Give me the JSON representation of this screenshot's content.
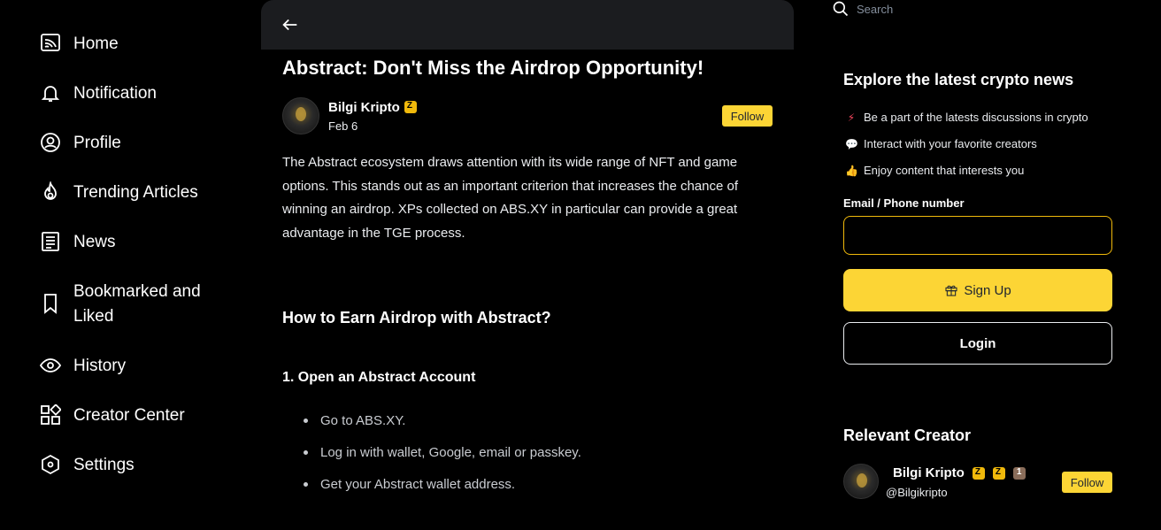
{
  "nav": {
    "items": [
      {
        "label": "Home",
        "icon": "home-screen-icon"
      },
      {
        "label": "Notification",
        "icon": "bell-icon"
      },
      {
        "label": "Profile",
        "icon": "user-icon"
      },
      {
        "label": "Trending Articles",
        "icon": "flame-icon"
      },
      {
        "label": "News",
        "icon": "news-icon"
      },
      {
        "label": "Bookmarked and Liked",
        "icon": "bookmark-icon"
      },
      {
        "label": "History",
        "icon": "eye-icon"
      },
      {
        "label": "Creator Center",
        "icon": "grid-icon"
      },
      {
        "label": "Settings",
        "icon": "settings-icon"
      }
    ]
  },
  "article": {
    "title": "Abstract: Don't Miss the Airdrop Opportunity!",
    "author": "Bilgi Kripto",
    "date": "Feb 6",
    "follow_label": "Follow",
    "paragraph": "The Abstract ecosystem draws attention with its wide range of NFT and game options. This stands out as an important criterion that increases the chance of winning an airdrop. XPs collected on ABS.XY in particular can provide a great advantage in the TGE process.",
    "heading": "How to Earn Airdrop with Abstract?",
    "subheading": "1. Open an Abstract Account",
    "bullets": [
      "Go to ABS.XY.",
      "Log in with wallet, Google, email or passkey.",
      "Get your Abstract wallet address."
    ]
  },
  "search": {
    "placeholder": "Search"
  },
  "promo": {
    "title": "Explore the latest crypto news",
    "items": [
      {
        "text": "Be a part of the latests discussions in crypto",
        "icon": "lightning-icon"
      },
      {
        "text": "Interact with your favorite creators",
        "icon": "speech-bubble-icon"
      },
      {
        "text": "Enjoy content that interests you",
        "icon": "thumbs-up-icon"
      }
    ],
    "email_label": "Email / Phone number",
    "email_value": "",
    "signup_label": "Sign Up",
    "login_label": "Login"
  },
  "relevant": {
    "title": "Relevant Creator",
    "name": "Bilgi Kripto",
    "handle": "@Bilgikripto",
    "follow_label": "Follow"
  },
  "colors": {
    "accent": "#fcd535",
    "background": "#000000",
    "topbar": "#1b1c1f"
  }
}
